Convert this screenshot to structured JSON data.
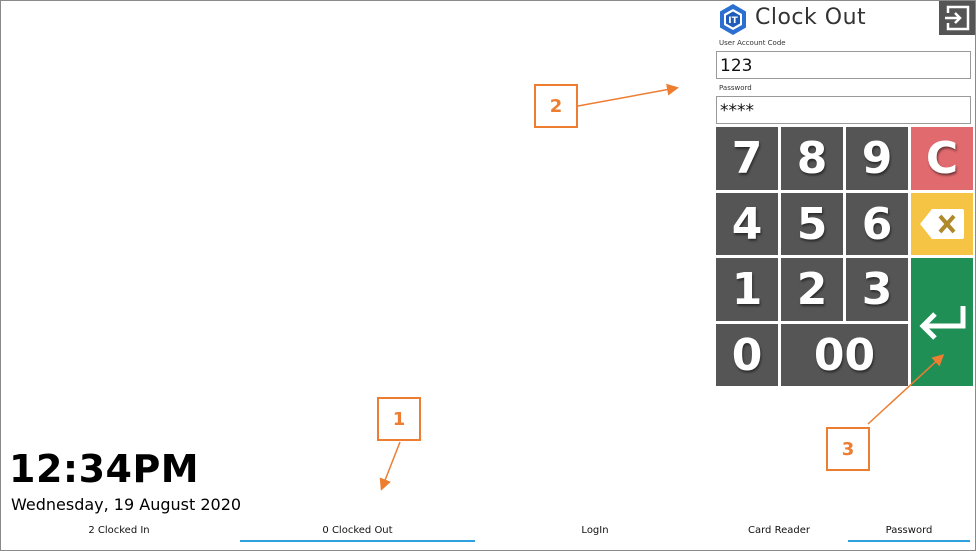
{
  "panel": {
    "title": "Clock Out",
    "exit_icon": "exit-icon",
    "logo_text": "IT",
    "user_code_label": "User Account Code",
    "user_code_value": "123",
    "password_label": "Password",
    "password_value": "****"
  },
  "keypad": {
    "k7": "7",
    "k8": "8",
    "k9": "9",
    "clear": "C",
    "k4": "4",
    "k5": "5",
    "k6": "6",
    "backspace_icon": "backspace-icon",
    "k1": "1",
    "k2": "2",
    "k3": "3",
    "enter_icon": "enter-icon",
    "k0": "0",
    "k00": "00"
  },
  "clock": {
    "time": "12:34PM",
    "date": "Wednesday, 19 August 2020"
  },
  "tabs": [
    {
      "label": "2 Clocked In"
    },
    {
      "label": "0 Clocked Out"
    },
    {
      "label": "LogIn"
    },
    {
      "label": "Card Reader"
    },
    {
      "label": "Password"
    }
  ],
  "annotations": [
    "1",
    "2",
    "3"
  ],
  "colors": {
    "key_dark": "#555555",
    "clear_red": "#e06a6e",
    "backspace_yellow": "#f5c445",
    "enter_green": "#1f8f56",
    "tab_underline": "#2ea0dd",
    "annotation_orange": "#ed7d31"
  }
}
